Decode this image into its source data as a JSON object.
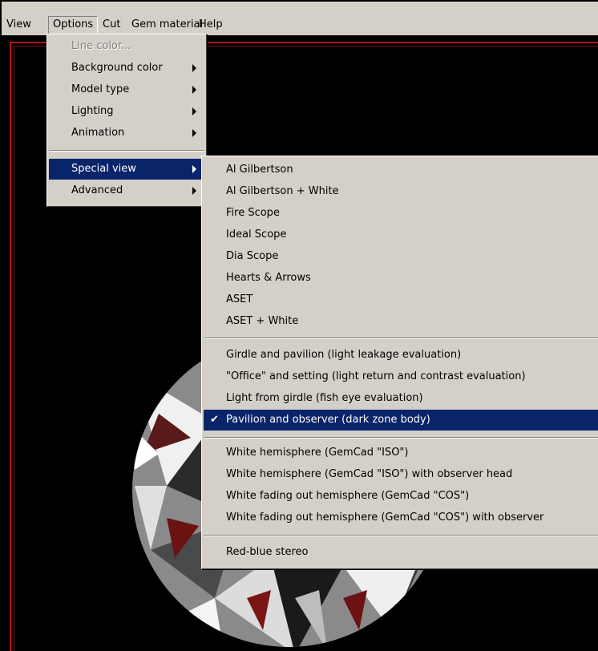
{
  "menubar": {
    "items": [
      "View",
      "Options",
      "Cut",
      "Gem material",
      "Help"
    ]
  },
  "options_menu": {
    "items": [
      {
        "label": "Line color...",
        "disabled": true,
        "submenu": false
      },
      {
        "label": "Background color",
        "submenu": true
      },
      {
        "label": "Model type",
        "submenu": true
      },
      {
        "label": "Lighting",
        "submenu": true
      },
      {
        "label": "Animation",
        "submenu": true
      },
      {
        "label": "Special view",
        "submenu": true,
        "highlighted": true
      },
      {
        "label": "Advanced",
        "submenu": true
      }
    ]
  },
  "special_view_menu": {
    "items": [
      "Al Gilbertson",
      "Al Gilbertson + White",
      "Fire Scope",
      "Ideal Scope",
      "Dia Scope",
      "Hearts & Arrows",
      "ASET",
      "ASET + White",
      "Girdle and pavilion (light leakage evaluation)",
      "\"Office\" and setting (light return and contrast evaluation)",
      "Light from girdle (fish eye evaluation)",
      "Pavilion and observer (dark zone body)",
      "White hemisphere (GemCad \"ISO\")",
      "White hemisphere (GemCad \"ISO\") with observer head",
      "White fading out hemisphere (GemCad \"COS\")",
      "White fading out hemisphere (GemCad \"COS\") with observer",
      "Red-blue stereo"
    ],
    "checked_item": "Pavilion and observer (dark zone body)",
    "check_glyph": "✔"
  },
  "colors": {
    "menu_bg": "#d4d0c8",
    "highlight": "#0a246a",
    "viewport_bg": "#000000",
    "frame_red": "#b01010"
  }
}
